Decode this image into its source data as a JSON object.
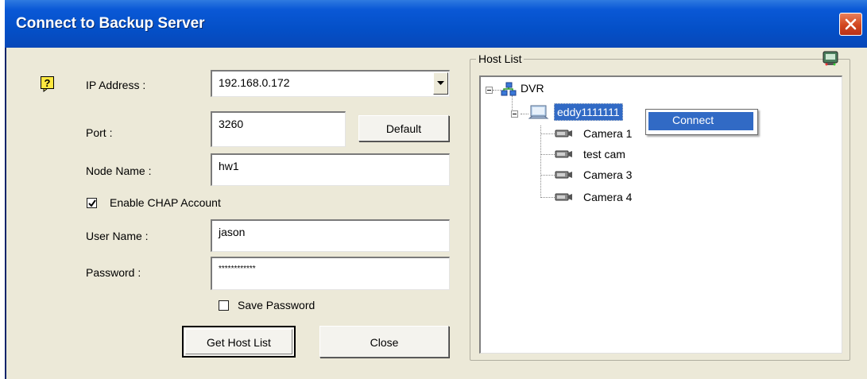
{
  "window": {
    "title": "Connect to Backup Server",
    "close_glyph": "✕"
  },
  "form": {
    "ip_label": "IP Address :",
    "ip_value": "192.168.0.172",
    "port_label": "Port :",
    "port_value": "3260",
    "default_button": "Default",
    "node_label": "Node Name :",
    "node_value": "hw1",
    "chap_label": "Enable CHAP Account",
    "chap_checked": true,
    "user_label": "User Name :",
    "user_value": "jason",
    "password_label": "Password :",
    "password_value": "************",
    "save_password_label": "Save Password",
    "save_password_checked": false,
    "get_host_list_button": "Get Host List",
    "close_button": "Close"
  },
  "host_list": {
    "title": "Host List",
    "root": "DVR",
    "host": "eddy1111111",
    "cameras": [
      "Camera 1",
      "test cam",
      "Camera 3",
      "Camera 4"
    ]
  },
  "context_menu": {
    "items": [
      "Connect"
    ]
  },
  "colors": {
    "title_bar": "#0450c8",
    "menu_highlight": "#316ac5",
    "frame": "#ece9d8"
  },
  "icons": {
    "help": "help-icon",
    "network": "network-icon",
    "monitor": "monitor-icon",
    "camera": "camera-icon",
    "refresh": "refresh-icon"
  }
}
